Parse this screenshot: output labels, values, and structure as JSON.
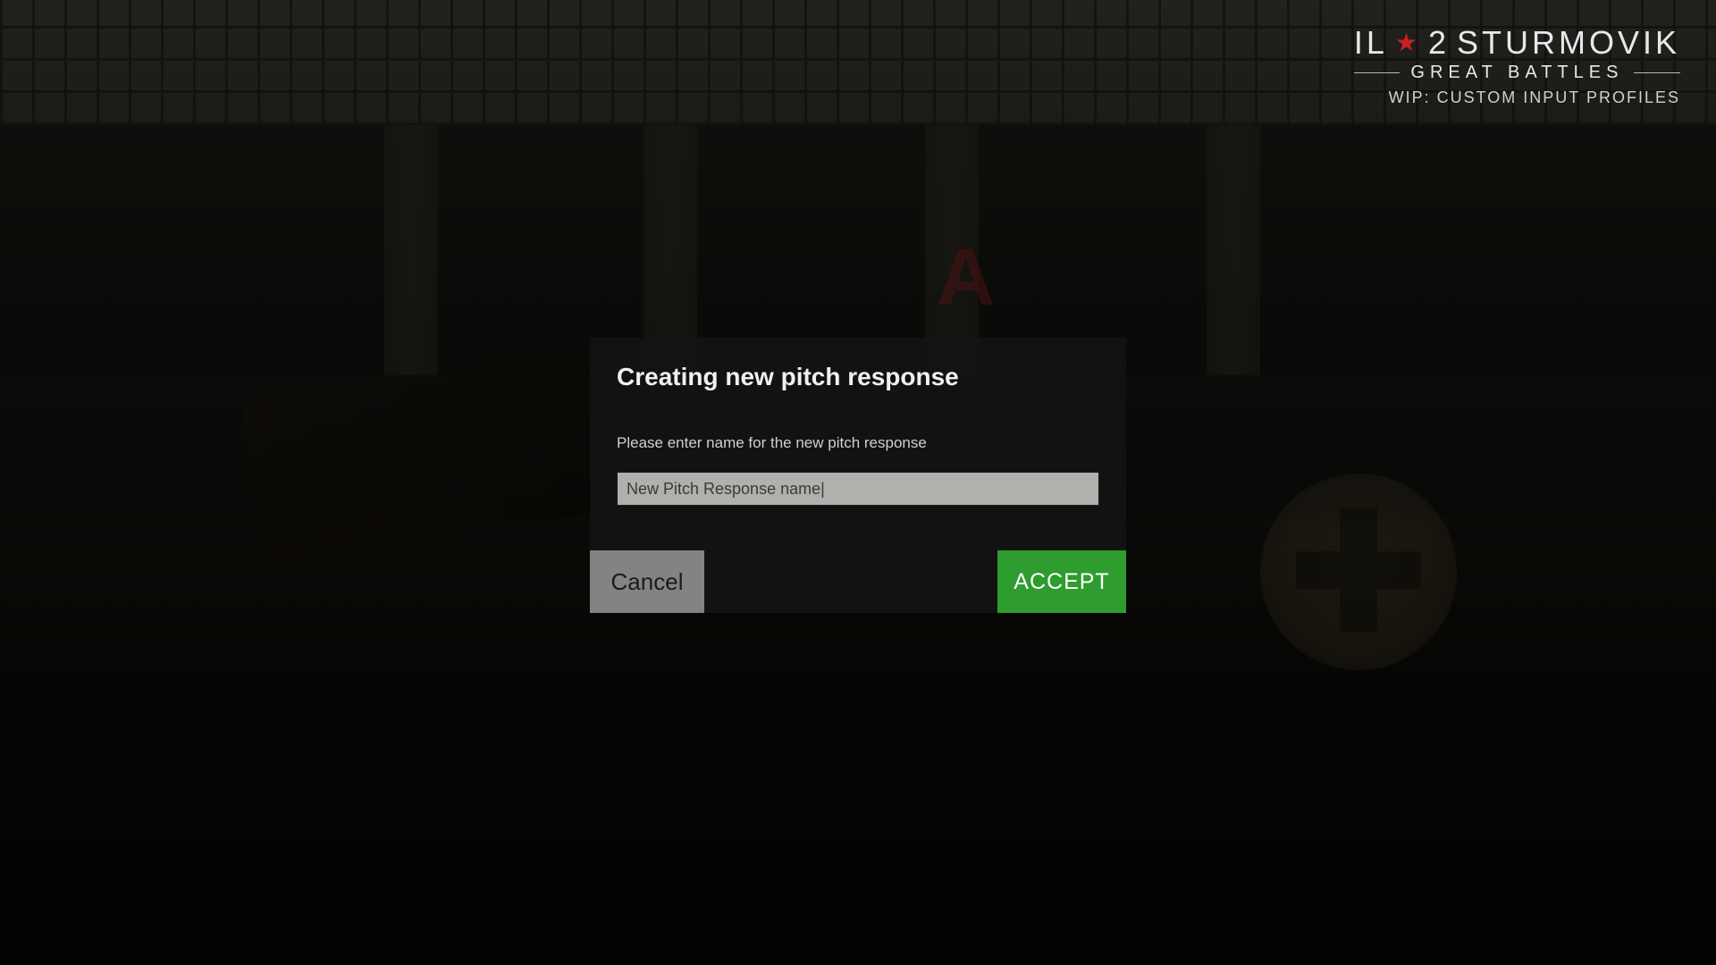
{
  "logo": {
    "il": "IL",
    "two": "2",
    "sturmovik": "STURMOVIK",
    "subtitle": "GREAT BATTLES",
    "wip": "WIP: CUSTOM INPUT PROFILES"
  },
  "background": {
    "wall_letter": "A"
  },
  "modal": {
    "title": "Creating new pitch response",
    "prompt": "Please enter name for the new pitch response",
    "input_value": "New Pitch Response name|",
    "cancel_label": "Cancel",
    "accept_label": "ACCEPT"
  },
  "colors": {
    "accept_green": "#2e9c2e",
    "cancel_gray": "#838383",
    "star_red": "#c82020"
  }
}
